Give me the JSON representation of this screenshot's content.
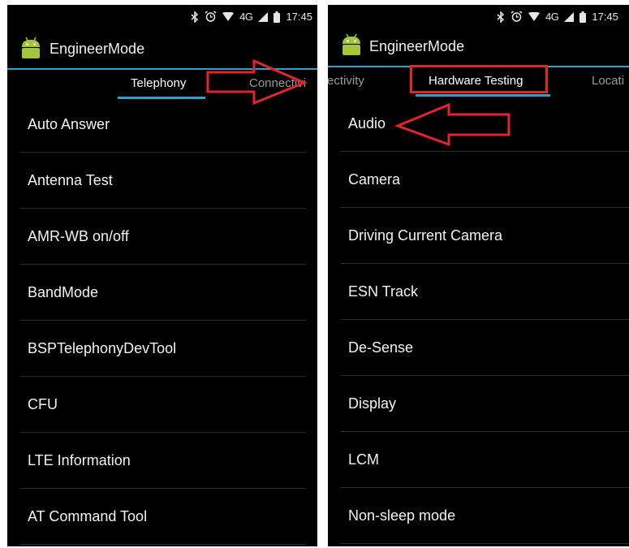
{
  "colors": {
    "accent": "#2fa0c8",
    "annotation": "#e3242b",
    "android_green": "#a4c639"
  },
  "left_screen": {
    "status": {
      "icons": [
        "bluetooth-icon",
        "alarm-icon",
        "wifi-icon",
        "signal-icon",
        "battery-icon"
      ],
      "network": "4G",
      "time": "17:45"
    },
    "app_title": "EngineerMode",
    "tabs": [
      {
        "label": "Telephony",
        "active": true
      },
      {
        "label": "Connectivi",
        "active": false
      }
    ],
    "items": [
      "Auto Answer",
      "Antenna Test",
      "AMR-WB on/off",
      "BandMode",
      "BSPTelephonyDevTool",
      "CFU",
      "LTE Information",
      "AT Command Tool"
    ]
  },
  "right_screen": {
    "status": {
      "icons": [
        "bluetooth-icon",
        "alarm-icon",
        "wifi-icon",
        "signal-icon",
        "battery-icon"
      ],
      "network": "4G",
      "time": "17:45"
    },
    "app_title": "EngineerMode",
    "tabs": [
      {
        "label": "ectivity",
        "active": false
      },
      {
        "label": "Hardware Testing",
        "active": true
      },
      {
        "label": "Locati",
        "active": false
      }
    ],
    "items": [
      "Audio",
      "Camera",
      "Driving Current Camera",
      "ESN Track",
      "De-Sense",
      "Display",
      "LCM",
      "Non-sleep mode"
    ]
  },
  "annotations": {
    "arrows": [
      "right-arrow",
      "left-arrow"
    ],
    "highlight": "Hardware Testing"
  }
}
